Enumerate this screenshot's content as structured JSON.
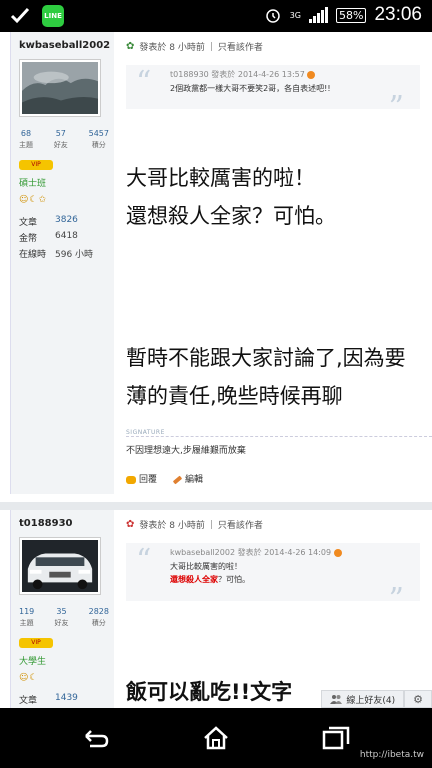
{
  "status_bar": {
    "line_app": "LINE",
    "network": "3G",
    "battery": "58%",
    "time": "23:06"
  },
  "posts": [
    {
      "username": "kwbaseball2002",
      "stats": [
        {
          "value": "68",
          "label": "主題"
        },
        {
          "value": "57",
          "label": "好友"
        },
        {
          "value": "5457",
          "label": "積分"
        }
      ],
      "rank_badge": "VIP",
      "rank": "碩士班",
      "info": [
        {
          "key": "文章",
          "value": "3826"
        },
        {
          "key": "金幣",
          "value": "6418"
        },
        {
          "key": "在線時",
          "value": "596 小時"
        }
      ],
      "meta": {
        "posted": "發表於 8 小時前",
        "only_author": "只看該作者"
      },
      "quote": {
        "head": "t0188930 發表於 2014-4-26 13:57",
        "body_line1": "2個政黨都一樣大哥不要笑2哥，各自表述吧!!"
      },
      "body_lines": [
        "大哥比較厲害的啦！",
        "還想殺人全家？可怕。"
      ],
      "notice_lines": [
        "暫時不能跟大家討論了,因為要",
        "薄的責任,晚些時候再聊"
      ],
      "signature_label": "SIGNATURE",
      "signature": "不因理想遠大,步履維艱而放棄",
      "actions": {
        "reply": "回覆",
        "edit": "編輯"
      }
    },
    {
      "username": "t0188930",
      "stats": [
        {
          "value": "119",
          "label": "主題"
        },
        {
          "value": "35",
          "label": "好友"
        },
        {
          "value": "2828",
          "label": "積分"
        }
      ],
      "rank_badge": "VIP",
      "rank": "大學生",
      "info": [
        {
          "key": "文章",
          "value": "1439"
        }
      ],
      "meta": {
        "posted": "發表於 8 小時前",
        "only_author": "只看該作者"
      },
      "quote": {
        "head": "kwbaseball2002 發表於 2014-4-26 14:09",
        "body_line1": "大哥比較厲害的啦！",
        "body_red": "還想殺人全家",
        "body_rest": "？可怕。"
      },
      "body_partial": "飯可以亂吃!!文字"
    }
  ],
  "friends_bar": {
    "label": "線上好友(4)"
  },
  "watermark": "http://ibeta.tw",
  "colors": {
    "accent_link": "#336699",
    "rank_green": "#339933",
    "quote_red": "#dd0000"
  }
}
